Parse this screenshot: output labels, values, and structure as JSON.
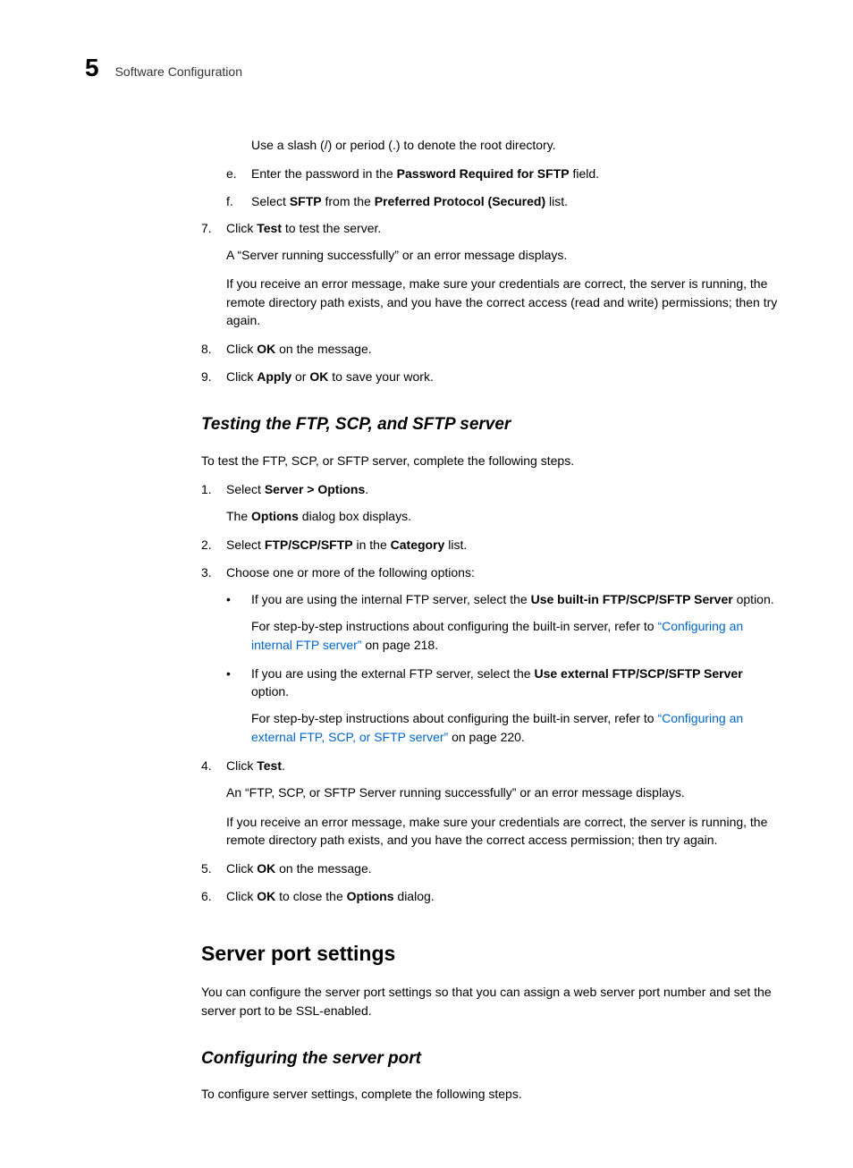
{
  "header": {
    "chapter_number": "5",
    "chapter_title": "Software Configuration"
  },
  "topBlock": {
    "sub_d": "Use a slash (/) or period (.) to denote the root directory.",
    "sub_e_marker": "e.",
    "sub_e_1": "Enter the password in the ",
    "sub_e_b": "Password Required for SFTP",
    "sub_e_2": " field.",
    "sub_f_marker": "f.",
    "sub_f_1": "Select ",
    "sub_f_b1": "SFTP",
    "sub_f_2": " from the ",
    "sub_f_b2": "Preferred Protocol (Secured)",
    "sub_f_3": " list.",
    "n7_marker": "7.",
    "n7_1": "Click ",
    "n7_b": "Test",
    "n7_2": " to test the server.",
    "n7_p1": "A “Server running successfully” or an error message displays.",
    "n7_p2": "If you receive an error message, make sure your credentials are correct, the server is running, the remote directory path exists, and you have the correct access (read and write) permissions; then try again.",
    "n8_marker": "8.",
    "n8_1": "Click ",
    "n8_b": "OK",
    "n8_2": " on the message.",
    "n9_marker": "9.",
    "n9_1": "Click ",
    "n9_b1": "Apply",
    "n9_2": " or ",
    "n9_b2": "OK",
    "n9_3": " to save your work."
  },
  "section1": {
    "title": "Testing the FTP, SCP, and SFTP server",
    "intro": "To test the FTP, SCP, or SFTP server, complete the following steps.",
    "s1_marker": "1.",
    "s1_1": "Select ",
    "s1_b": "Server > Options",
    "s1_2": ".",
    "s1_p1a": "The ",
    "s1_p1b": "Options",
    "s1_p1c": " dialog box displays.",
    "s2_marker": "2.",
    "s2_1": "Select ",
    "s2_b1": "FTP/SCP/SFTP",
    "s2_2": " in the ",
    "s2_b2": "Category",
    "s2_3": " list.",
    "s3_marker": "3.",
    "s3_1": "Choose one or more of the following options:",
    "b1_1": "If you are using the internal FTP server, select the ",
    "b1_b": "Use built-in FTP/SCP/SFTP Server",
    "b1_2": " option.",
    "b1_p1a": "For step-by-step instructions about configuring the built-in server, refer to ",
    "b1_link": "“Configuring an internal FTP server”",
    "b1_p1b": " on page 218.",
    "b2_1": "If you are using the external FTP server, select the ",
    "b2_b": "Use external FTP/SCP/SFTP Server",
    "b2_2": " option.",
    "b2_p1a": "For step-by-step instructions about configuring the built-in server, refer to ",
    "b2_link": "“Configuring an external FTP, SCP, or SFTP server”",
    "b2_p1b": " on page 220.",
    "s4_marker": "4.",
    "s4_1": "Click ",
    "s4_b": "Test",
    "s4_2": ".",
    "s4_p1": "An “FTP, SCP, or SFTP Server running successfully” or an error message displays.",
    "s4_p2": "If you receive an error message, make sure your credentials are correct, the server is running, the remote directory path exists, and you have the correct access permission; then try again.",
    "s5_marker": "5.",
    "s5_1": "Click ",
    "s5_b": "OK",
    "s5_2": " on the message.",
    "s6_marker": "6.",
    "s6_1": "Click ",
    "s6_b1": "OK",
    "s6_2": " to close the ",
    "s6_b2": "Options",
    "s6_3": " dialog."
  },
  "section2": {
    "title": "Server port settings",
    "intro": "You can configure the server port settings so that you can assign a web server port number and set the server port to be SSL-enabled."
  },
  "section3": {
    "title": "Configuring the server port",
    "intro": "To configure server settings, complete the following steps."
  }
}
